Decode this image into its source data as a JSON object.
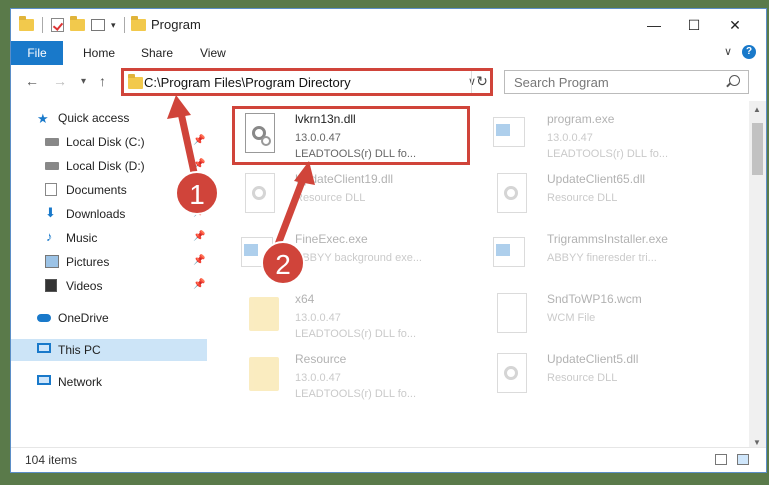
{
  "window": {
    "title": "Program",
    "minimize": "—",
    "maximize": "☐",
    "close": "✕"
  },
  "ribbon": {
    "file": "File",
    "home": "Home",
    "share": "Share",
    "view": "View",
    "help": "?"
  },
  "nav": {
    "back": "←",
    "forward": "→",
    "recent": "▾",
    "up": "↑",
    "address": "C:\\Program Files\\Program Directory",
    "address_dropdown": "∨",
    "refresh": "↻",
    "search_placeholder": "Search Program"
  },
  "sidebar": {
    "items": [
      {
        "label": "Quick access",
        "icon": "star-icon"
      },
      {
        "label": "Local Disk (C:)",
        "icon": "drive-icon"
      },
      {
        "label": "Local Disk (D:)",
        "icon": "drive-icon"
      },
      {
        "label": "Documents",
        "icon": "documents-icon"
      },
      {
        "label": "Downloads",
        "icon": "download-icon"
      },
      {
        "label": "Music",
        "icon": "music-icon"
      },
      {
        "label": "Pictures",
        "icon": "pictures-icon"
      },
      {
        "label": "Videos",
        "icon": "videos-icon"
      },
      {
        "label": "OneDrive",
        "icon": "cloud-icon"
      },
      {
        "label": "This PC",
        "icon": "computer-icon"
      },
      {
        "label": "Network",
        "icon": "network-icon"
      }
    ]
  },
  "files": [
    {
      "name": "lvkrn13n.dll",
      "line1": "13.0.0.47",
      "line2": "LEADTOOLS(r) DLL fo..."
    },
    {
      "name": "program.exe",
      "line1": "13.0.0.47",
      "line2": "LEADTOOLS(r) DLL fo..."
    },
    {
      "name": "UpdateClient19.dll",
      "line1": "Resource DLL",
      "line2": ""
    },
    {
      "name": "UpdateClient65.dll",
      "line1": "Resource DLL",
      "line2": ""
    },
    {
      "name": "FineExec.exe",
      "line1": "ABBYY background exe...",
      "line2": ""
    },
    {
      "name": "TrigrammsInstaller.exe",
      "line1": "ABBYY fineresder tri...",
      "line2": ""
    },
    {
      "name": "x64",
      "line1": "13.0.0.47",
      "line2": "LEADTOOLS(r) DLL fo..."
    },
    {
      "name": "SndToWP16.wcm",
      "line1": "WCM File",
      "line2": ""
    },
    {
      "name": "Resource",
      "line1": "13.0.0.47",
      "line2": "LEADTOOLS(r) DLL fo..."
    },
    {
      "name": "UpdateClient5.dll",
      "line1": "Resource DLL",
      "line2": ""
    }
  ],
  "status": {
    "count": "104 items"
  },
  "annotations": {
    "step1": "1",
    "step2": "2",
    "highlight_color": "#d0443a"
  }
}
